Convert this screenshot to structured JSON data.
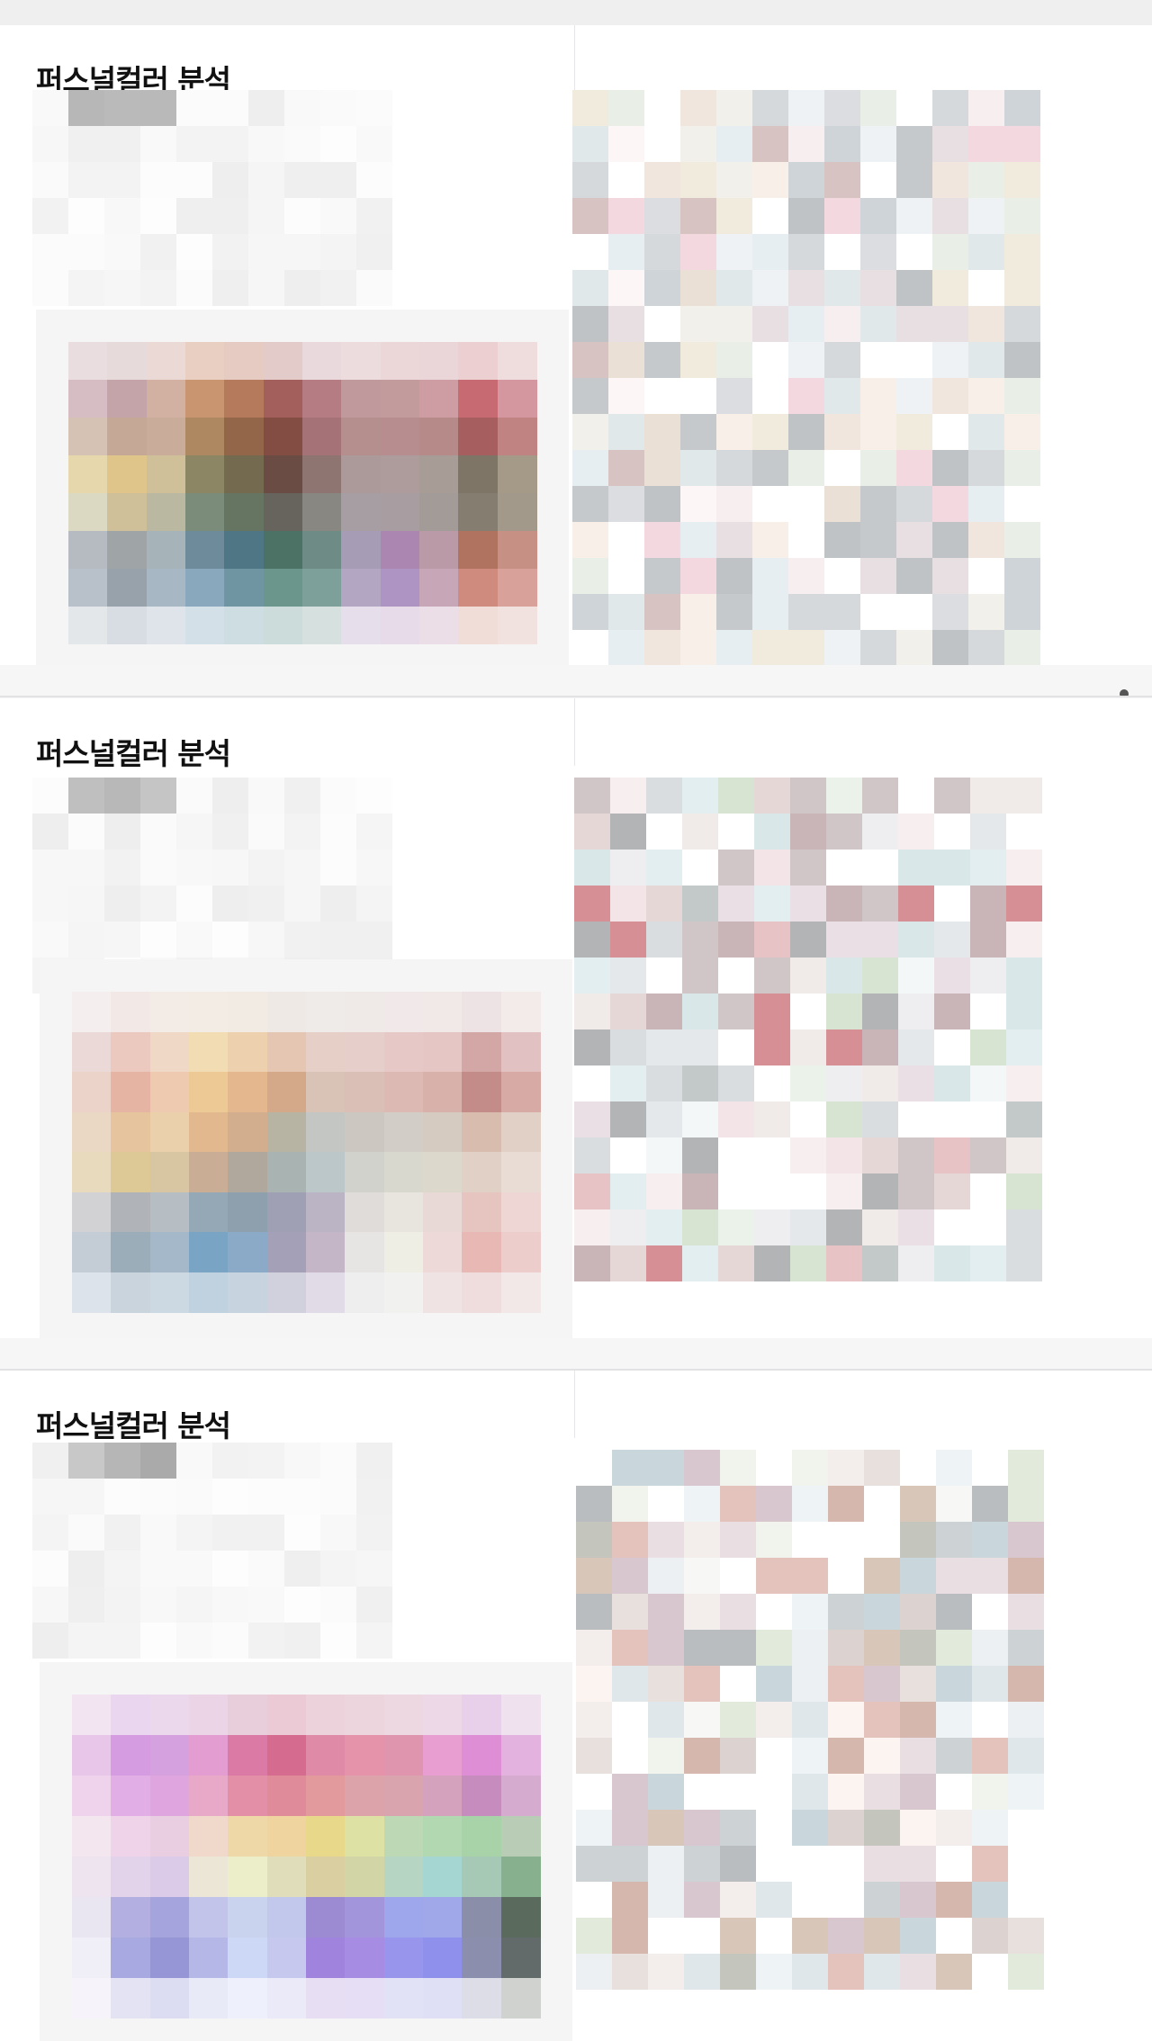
{
  "cards": [
    {
      "title": "퍼스널컬러 분석"
    },
    {
      "title": "퍼스널컬러 분석"
    },
    {
      "title": "퍼스널컬러 분석"
    }
  ],
  "palettes": {
    "card1": [
      [
        "#eadde0",
        "#e6dada",
        "#ead9d5",
        "#e8cfc2",
        "#e5cbc2",
        "#e2cbc9",
        "#ead9dc",
        "#eddcdd",
        "#ebd7d8",
        "#ead5d8",
        "#eccfd0",
        "#efdcdc"
      ],
      [
        "#d6bcc3",
        "#c4a3a9",
        "#d2b1a3",
        "#c99570",
        "#b57a5c",
        "#a35f5c",
        "#b67c83",
        "#c0999d",
        "#c29b9d",
        "#ce9da3",
        "#c86a72",
        "#d4979f"
      ],
      [
        "#d5c2b4",
        "#c6a896",
        "#c9ad9a",
        "#ad8860",
        "#93664a",
        "#844d44",
        "#a57377",
        "#b48f8e",
        "#b78d8f",
        "#b58a88",
        "#a75e5e",
        "#c08382"
      ],
      [
        "#e7d7ac",
        "#dfc58a",
        "#cfc09a",
        "#8d8664",
        "#736a4f",
        "#6b4c44",
        "#8f7572",
        "#ab9a99",
        "#ae9b9b",
        "#a89c96",
        "#7f7566",
        "#a59987"
      ],
      [
        "#dcd9c3",
        "#cfc09a",
        "#bab8a1",
        "#7b8d7a",
        "#657562",
        "#67645d",
        "#898782",
        "#a79ea3",
        "#a89ea2",
        "#a29b98",
        "#857d70",
        "#a3998b"
      ],
      [
        "#b5bbc0",
        "#9fa4a6",
        "#a6b3b8",
        "#6d8b9b",
        "#4f7684",
        "#4c7266",
        "#6e8b86",
        "#a79cb6",
        "#aa86b0",
        "#bb9aa8",
        "#b0735f",
        "#c69184"
      ],
      [
        "#b8c1c9",
        "#98a2aa",
        "#a7b8c4",
        "#8aa8bd",
        "#6f95a2",
        "#6b968b",
        "#7ea09a",
        "#b2a6c3",
        "#ae94c2",
        "#c6a6b7",
        "#cf8b7d",
        "#d8a19a"
      ],
      [
        "#e3e7ea",
        "#d7dde2",
        "#dee4ea",
        "#d4e0e8",
        "#cddde2",
        "#cbdcda",
        "#d6e0df",
        "#e6dfeb",
        "#e7dbe9",
        "#ebdee6",
        "#f0ddd8",
        "#f1e2df"
      ]
    ],
    "card2": [
      [
        "#f5eeee",
        "#f2e8e6",
        "#f2ebe6",
        "#f3ece4",
        "#f1ebe4",
        "#efe9e6",
        "#efebe9",
        "#efe9e8",
        "#f0e8e9",
        "#f1e8e8",
        "#eee3e4",
        "#f3eaea"
      ],
      [
        "#ebd9d8",
        "#ecc9bf",
        "#efd8c6",
        "#f1dcb4",
        "#edd1af",
        "#e4c6b2",
        "#e6cfc7",
        "#e6cfca",
        "#e6c8c6",
        "#e5c6c4",
        "#d4a7a7",
        "#e1c1c1"
      ],
      [
        "#ecd3c9",
        "#e6b4a2",
        "#eecbb0",
        "#ecc995",
        "#e4b78e",
        "#d3a989",
        "#d9c2b6",
        "#dabfb6",
        "#dcb9b3",
        "#d9b1ab",
        "#c48c89",
        "#d8aaa6"
      ],
      [
        "#ead7c4",
        "#e6c59e",
        "#ead1ac",
        "#e2b98f",
        "#d2ae8e",
        "#b7b4a4",
        "#c4c6c4",
        "#ccc7c1",
        "#d2cdc6",
        "#d6cbc0",
        "#d8bcae",
        "#e1d0c6"
      ],
      [
        "#e8dbbd",
        "#ddc996",
        "#d8c6a3",
        "#c9ae95",
        "#b0a89c",
        "#a8b3b2",
        "#bcc7ca",
        "#d0d2cb",
        "#d9d8ce",
        "#dcd8cc",
        "#e0d0c6",
        "#e8dcd4"
      ],
      [
        "#d2d2d4",
        "#b0b4b8",
        "#b6bec4",
        "#94a8b6",
        "#8ea0ae",
        "#a0a0b4",
        "#bab4c4",
        "#e0dcd9",
        "#e7e5dd",
        "#e8d8d6",
        "#e6c4c0",
        "#edd6d4"
      ],
      [
        "#c4ccd6",
        "#9cadba",
        "#a4b8c9",
        "#7aa4c4",
        "#8aaac8",
        "#a4a0b8",
        "#c4b6c6",
        "#e7e4e4",
        "#efeee4",
        "#ecd9d8",
        "#e8b8b5",
        "#edcdcb"
      ],
      [
        "#dde3ea",
        "#c9d4dd",
        "#ccd9e2",
        "#c0d1df",
        "#c8d3e0",
        "#d1d1de",
        "#e0dbe6",
        "#eeeeee",
        "#f1f1ef",
        "#f0e3e4",
        "#efdcdc",
        "#f2e8e8"
      ]
    ],
    "card3": [
      [
        "#f2e4f1",
        "#ebd6ef",
        "#ebd8ec",
        "#ead4e6",
        "#e8cdda",
        "#ebc9d5",
        "#ebd2db",
        "#edd5dd",
        "#edd7e0",
        "#ecd8e7",
        "#e8d0ea",
        "#f0e1ee"
      ],
      [
        "#e8c6ea",
        "#d69ce2",
        "#d6a1df",
        "#e39dd1",
        "#dc7aa6",
        "#d56b8f",
        "#df8aa6",
        "#e593aa",
        "#e095ae",
        "#e89ed0",
        "#de8ed4",
        "#e3b2de"
      ],
      [
        "#efd2ec",
        "#e2aee6",
        "#dea5de",
        "#e8a8c8",
        "#e38fa8",
        "#e08b9a",
        "#e39a9c",
        "#dca3ab",
        "#d9a4ae",
        "#d5a2be",
        "#c58cbd",
        "#d5acd0"
      ],
      [
        "#f4e6ee",
        "#eed3e9",
        "#e9cde1",
        "#f0d8cb",
        "#efd8a8",
        "#f0d49f",
        "#e8d88a",
        "#dde2a4",
        "#bcd8b5",
        "#b1d8b0",
        "#a8d2a8",
        "#b9ccb5"
      ],
      [
        "#eee4ef",
        "#e2d2ea",
        "#dbcbe8",
        "#ece6d6",
        "#eceec9",
        "#e0ddbb",
        "#dacfa1",
        "#d2d6a6",
        "#b6d6c3",
        "#a6d6d2",
        "#a5c9b5",
        "#86b08e"
      ],
      [
        "#e9e6f2",
        "#b3afe0",
        "#a6a4dc",
        "#c3c4ea",
        "#c9d3ee",
        "#c2c8ec",
        "#9c8ad2",
        "#a295db",
        "#9ea6ec",
        "#a0a8ea",
        "#8a8ea8",
        "#5a6a5d"
      ],
      [
        "#f0eef6",
        "#a9a9e2",
        "#9696d7",
        "#b5b8e6",
        "#ccd8f5",
        "#c6c8ee",
        "#a083dc",
        "#a68ce3",
        "#9896ec",
        "#8e90eb",
        "#8c8eae",
        "#626b69"
      ],
      [
        "#f6f4fa",
        "#e3e3f4",
        "#dcdcf2",
        "#e8eaf7",
        "#eef0fb",
        "#eaeaf8",
        "#e7def4",
        "#e5def5",
        "#e2e2f6",
        "#dfe0f6",
        "#dcdde6",
        "#cfd2cf"
      ]
    ]
  },
  "photo_blocks": {
    "card1": {
      "cols": 13,
      "rows": 17,
      "palette": [
        "#ffffff",
        "#fdf6f7",
        "#f7eef0",
        "#eef2f4",
        "#e8dfe2",
        "#dcdde0",
        "#cfd4d8",
        "#f1e6dd",
        "#f0ebdc",
        "#e9efe6",
        "#f3d9df",
        "#d8c3c3",
        "#bfc3c6",
        "#e6eef2",
        "#f8efe9",
        "#ebe0d5",
        "#d5d9dc",
        "#c5c9cc",
        "#f2f0ea",
        "#e0e8ea"
      ]
    },
    "card2": {
      "cols": 13,
      "rows": 14,
      "palette": [
        "#ffffff",
        "#f7eef0",
        "#f3e4e8",
        "#eeeef0",
        "#e5e8ea",
        "#dadde0",
        "#d0c6c8",
        "#e7c3c6",
        "#d68f95",
        "#c9b4b7",
        "#f3f7f8",
        "#e3eef0",
        "#d9e7e8",
        "#ebf2ea",
        "#d8e4d2",
        "#c3c8c8",
        "#b2b4b6",
        "#f0ebe8",
        "#e4d7d5",
        "#eadfe4"
      ]
    },
    "card3": {
      "cols": 13,
      "rows": 15,
      "palette": [
        "#ffffff",
        "#fbf4f1",
        "#f3eeeb",
        "#e8e0dd",
        "#dcd3d1",
        "#d8c7b8",
        "#e3c3bc",
        "#d5b7ae",
        "#c4c6bd",
        "#e2eadb",
        "#f1f4ec",
        "#ecf0f2",
        "#dfe7ea",
        "#c9d6dc",
        "#d9c7cf",
        "#e9dfe2",
        "#eef3f5",
        "#cdd2d5",
        "#b9bdbf",
        "#f7f7f6"
      ]
    }
  }
}
